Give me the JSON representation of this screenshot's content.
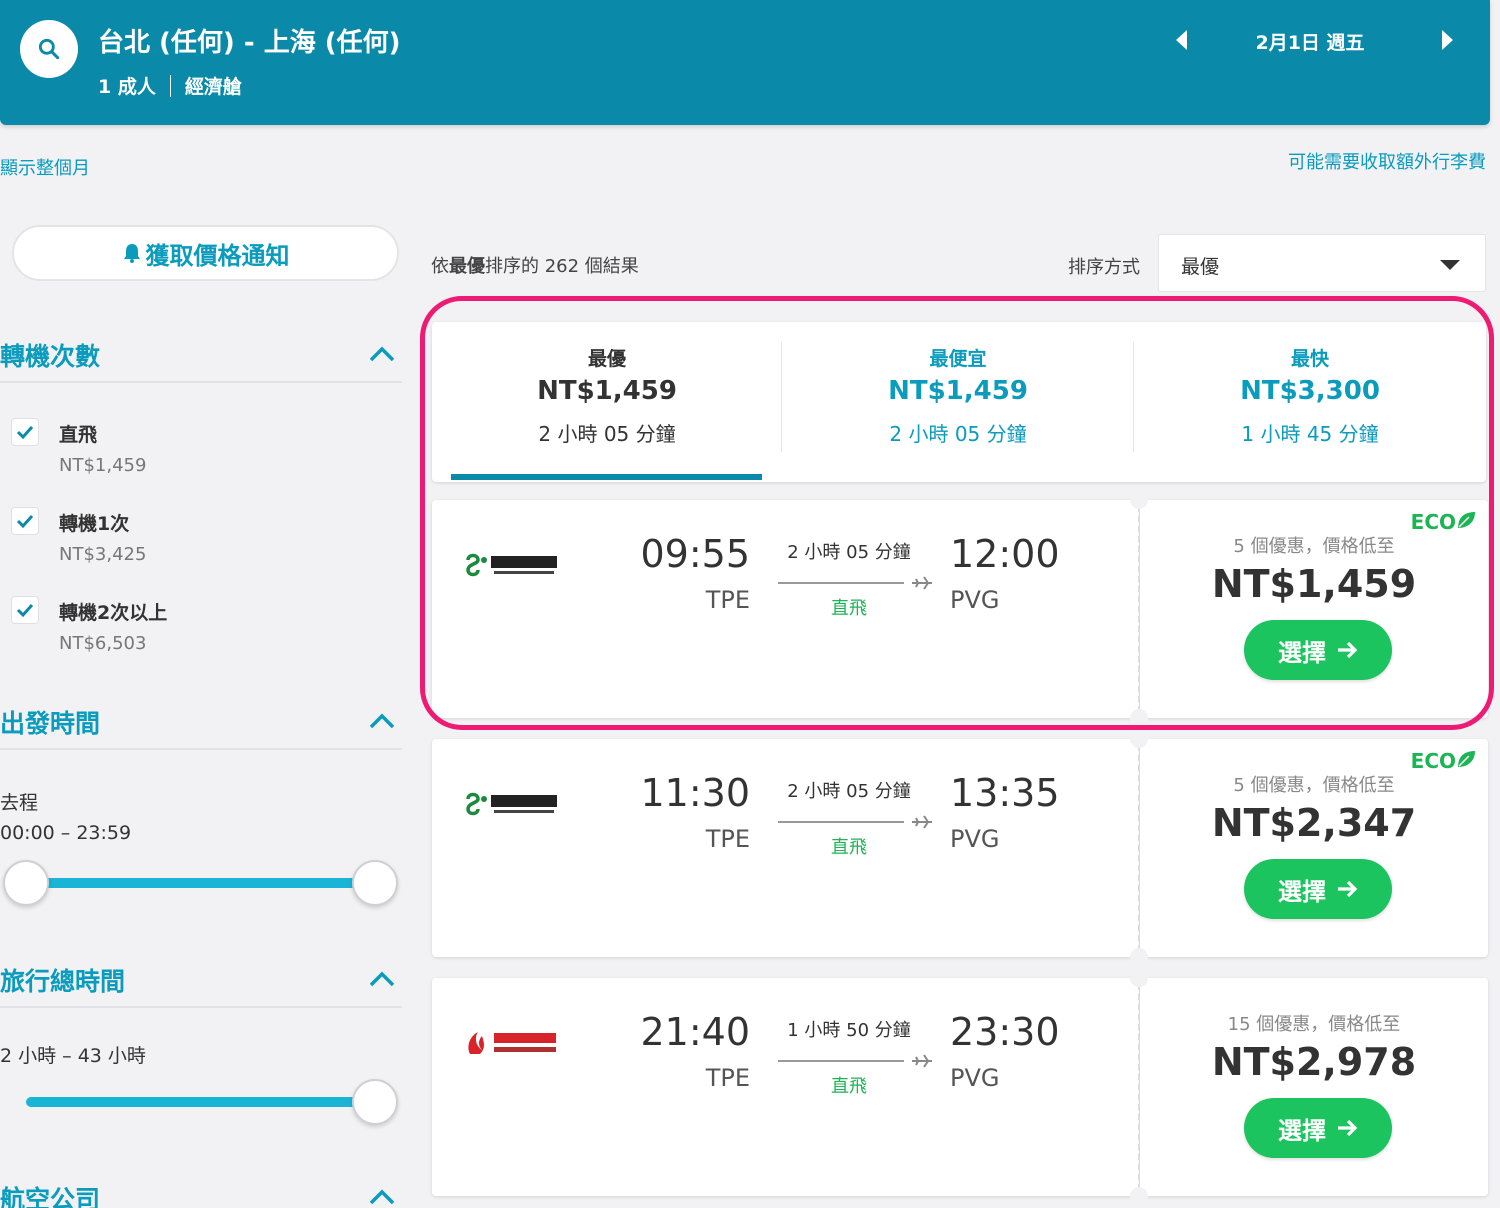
{
  "header": {
    "route": "台北 (任何) - 上海 (任何)",
    "passengers": "1 成人",
    "cabin": "經濟艙",
    "date": "2月1日 週五"
  },
  "links": {
    "show_month": "顯示整個月",
    "extra_fee": "可能需要收取額外行李費"
  },
  "sidebar": {
    "alert_label": "獲取價格通知",
    "stops": {
      "title": "轉機次數",
      "options": [
        {
          "label": "直飛",
          "price": "NT$1,459",
          "checked": true
        },
        {
          "label": "轉機1次",
          "price": "NT$3,425",
          "checked": true
        },
        {
          "label": "轉機2次以上",
          "price": "NT$6,503",
          "checked": true
        }
      ]
    },
    "departure": {
      "title": "出發時間",
      "leg_label": "去程",
      "range": "00:00 – 23:59"
    },
    "duration": {
      "title": "旅行總時間",
      "range": "2 小時 – 43 小時"
    },
    "airlines": {
      "title": "航空公司"
    }
  },
  "results": {
    "count_prefix": "依",
    "count_bold": "最優",
    "count_suffix": "排序的 262 個結果",
    "sort_label": "排序方式",
    "sort_value": "最優"
  },
  "tabs": [
    {
      "name": "最優",
      "price": "NT$1,459",
      "duration": "2 小時 05 分鐘",
      "active": true
    },
    {
      "name": "最便宜",
      "price": "NT$1,459",
      "duration": "2 小時 05 分鐘",
      "active": false
    },
    {
      "name": "最快",
      "price": "NT$3,300",
      "duration": "1 小時 45 分鐘",
      "active": false
    }
  ],
  "flights": [
    {
      "airline": "spring-airlines",
      "dep_time": "09:55",
      "dep_code": "TPE",
      "duration": "2 小時 05 分鐘",
      "stops": "直飛",
      "arr_time": "12:00",
      "arr_code": "PVG",
      "eco": "ECO",
      "deals": "5 個優惠，價格低至",
      "price": "NT$1,459",
      "select": "選擇"
    },
    {
      "airline": "spring-airlines",
      "dep_time": "11:30",
      "dep_code": "TPE",
      "duration": "2 小時 05 分鐘",
      "stops": "直飛",
      "arr_time": "13:35",
      "arr_code": "PVG",
      "eco": "ECO",
      "deals": "5 個優惠，價格低至",
      "price": "NT$2,347",
      "select": "選擇"
    },
    {
      "airline": "air-china",
      "dep_time": "21:40",
      "dep_code": "TPE",
      "duration": "1 小時 50 分鐘",
      "stops": "直飛",
      "arr_time": "23:30",
      "arr_code": "PVG",
      "eco": "",
      "deals": "15 個優惠，價格低至",
      "price": "NT$2,978",
      "select": "選擇"
    }
  ],
  "colors": {
    "header_bg": "#0a8aa8",
    "accent": "#0a9bbd",
    "select_green": "#1cc45f",
    "direct_green": "#1cb556",
    "highlight": "#ee1b74"
  }
}
